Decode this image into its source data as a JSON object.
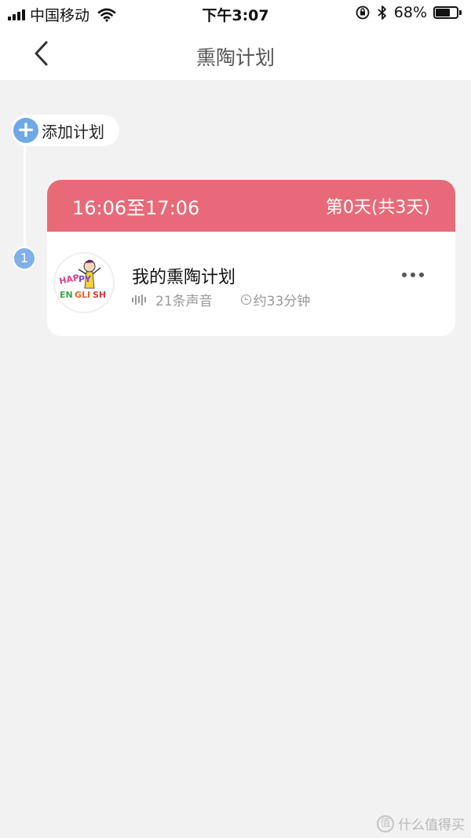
{
  "status_bar": {
    "carrier": "中国移动",
    "time": "下午3:07",
    "battery_percent": "68%",
    "battery_level": 0.68,
    "signal_bars": 4
  },
  "nav": {
    "title": "熏陶计划",
    "back_icon": "chevron-left-icon"
  },
  "timeline": {
    "add_label": "添加计划",
    "add_icon": "plus-icon",
    "step_number": "1"
  },
  "plan": {
    "time_range": "16:06至17:06",
    "day_progress": "第0天(共3天)",
    "name": "我的熏陶计划",
    "sound_count": "21条声音",
    "duration": "约33分钟",
    "cover_logo": "HAPPY ENGLISH",
    "header_color": "#e86a78"
  },
  "watermark": {
    "text": "什么值得买",
    "logo_char": "值"
  }
}
